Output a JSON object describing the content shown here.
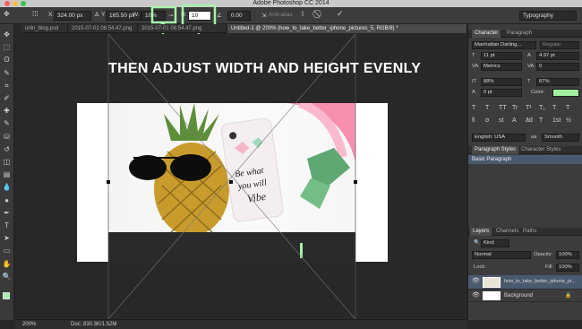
{
  "window": {
    "title": "Adobe Photoshop CC 2014"
  },
  "options": {
    "x_value": "324.00 px",
    "y_value": "165.50 px",
    "w_label": "W:",
    "w_value": "10%",
    "h_label": "H:",
    "h_value": "10",
    "angle_value": "0.00",
    "antialias_label": "Anti-alias",
    "workspace": "Typography",
    "cancel_icon": "⃠",
    "commit_icon": "✓"
  },
  "tabs": [
    {
      "label": "urlin_blog.psd"
    },
    {
      "label": "2015-07-01 08.54.47.png"
    },
    {
      "label": "2015-07-01 08.54.47.png"
    },
    {
      "label": "Untitled-1 @ 200% (how_to_take_better_iphone_pictures_5, RGB/8) *"
    }
  ],
  "canvas": {
    "instruction": "THEN ADJUST WIDTH AND HEIGHT EVENLY",
    "phone_text": "Be what you will be Vibe"
  },
  "status": {
    "zoom": "200%",
    "doc": "Doc: 830.3K/1.52M"
  },
  "character_panel": {
    "tabs": [
      "Character",
      "Paragraph"
    ],
    "font_family": "Manhattan Darling...",
    "font_style": "Regular",
    "size": "11 pt",
    "leading": "4.97 pt",
    "kerning": "Metrics",
    "tracking": "0",
    "vscale": "88%",
    "hscale": "87%",
    "baseline": "0 pt",
    "color_label": "Color:",
    "language": "English: USA",
    "aa": "Smooth",
    "aa_prefix": "aa",
    "style_buttons": [
      "T",
      "T",
      "TT",
      "Tr",
      "T¹",
      "T₁",
      "T",
      "T"
    ],
    "ot_buttons": [
      "fi",
      "σ",
      "st",
      "A",
      "ād",
      "T",
      "1st",
      "½"
    ],
    "color_value": "#a0f0a0"
  },
  "styles_panel": {
    "tabs": [
      "Paragraph Styles",
      "Character Styles"
    ],
    "items": [
      "Basic Paragraph"
    ]
  },
  "layers_panel": {
    "tabs": [
      "Layers",
      "Channels",
      "Paths"
    ],
    "filter": "Kind",
    "blend_mode": "Normal",
    "opacity_label": "Opacity:",
    "opacity": "100%",
    "lock_label": "Lock:",
    "fill_label": "Fill:",
    "fill": "100%",
    "layers": [
      {
        "name": "how_to_take_better_iphone_pi..."
      },
      {
        "name": "Background"
      }
    ]
  },
  "icons": {
    "tools": [
      "move-tool",
      "marquee-tool",
      "lasso-tool",
      "quick-select-tool",
      "crop-tool",
      "eyedropper-tool",
      "healing-brush-tool",
      "brush-tool",
      "clone-stamp-tool",
      "history-brush-tool",
      "eraser-tool",
      "gradient-tool",
      "blur-tool",
      "dodge-tool",
      "pen-tool",
      "type-tool",
      "path-select-tool",
      "shape-tool",
      "hand-tool",
      "zoom-tool"
    ],
    "tool_glyphs": [
      "✥",
      "⬚",
      "ʘ",
      "✎",
      "⌗",
      "✐",
      "✚",
      "✎",
      "⛁",
      "↺",
      "◫",
      "▤",
      "💧",
      "●",
      "✒",
      "T",
      "➤",
      "▭",
      "✋",
      "🔍"
    ],
    "accent": "#a5f2a9"
  }
}
